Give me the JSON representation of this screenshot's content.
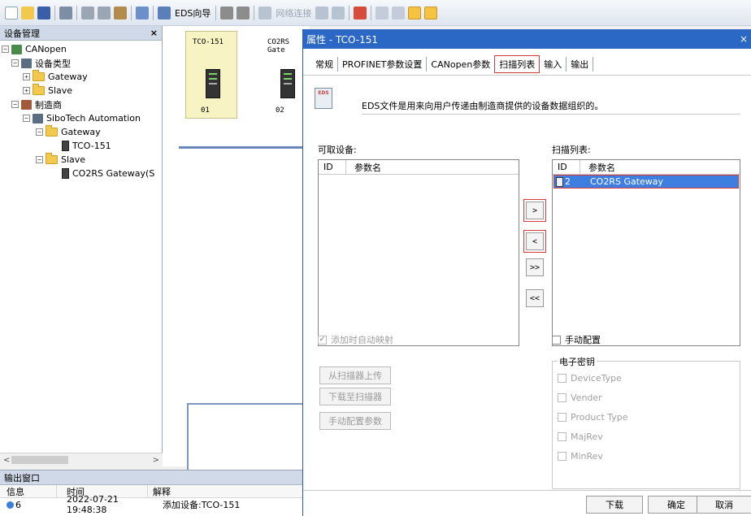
{
  "toolbar": {
    "eds_wizard": "EDS向导",
    "network_connect": "网络连接"
  },
  "device_panel": {
    "title": "设备管理",
    "close": "×",
    "tree": {
      "root": "CANopen",
      "device_type": "设备类型",
      "gateway_1": "Gateway",
      "slave_1": "Slave",
      "manufacturer": "制造商",
      "vendor": "SiboTech Automation",
      "gateway_2": "Gateway",
      "tco": "TCO-151",
      "slave_2": "Slave",
      "co2rs": "CO2RS Gateway(S"
    },
    "scroll_left": "<",
    "scroll_right": ">"
  },
  "canvas": {
    "dev1_label": "TCO-151",
    "dev1_num": "01",
    "dev2_label": "CO2RS Gate",
    "dev2_num": "02"
  },
  "output": {
    "title": "输出窗口",
    "headers": [
      "信息",
      "时间",
      "解释"
    ],
    "rows": [
      {
        "info": "6",
        "time": "2022-07-21 19:48:38",
        "desc": "添加设备:TCO-151"
      }
    ]
  },
  "dialog": {
    "title": "属性 - TCO-151",
    "close": "×",
    "tabs": [
      "常规",
      "PROFINET参数设置",
      "CANopen参数",
      "扫描列表",
      "输入",
      "输出"
    ],
    "active_tab": "扫描列表",
    "eds_icon": "EDS",
    "eds_desc": "EDS文件是用来向用户传递由制造商提供的设备数据组织的。",
    "available_label": "可取设备:",
    "scanlist_label": "扫描列表:",
    "col_id": "ID",
    "col_name": "参数名",
    "scan_rows": [
      {
        "id": "2",
        "name": "CO2RS Gateway"
      }
    ],
    "btn_add": ">",
    "btn_remove": "<",
    "btn_add_all": ">>",
    "btn_remove_all": "<<",
    "auto_map": "添加时自动映射",
    "manual_config": "手动配置",
    "upload": "从扫描器上传",
    "download_scanner": "下载至扫描器",
    "manual_params": "手动配置参数",
    "ekey_title": "电子密钥",
    "ekeys": [
      "DeviceType",
      "Vender",
      "Product Type",
      "MajRev",
      "MinRev"
    ],
    "btn_download": "下载",
    "btn_ok": "确定",
    "btn_cancel": "取消"
  }
}
